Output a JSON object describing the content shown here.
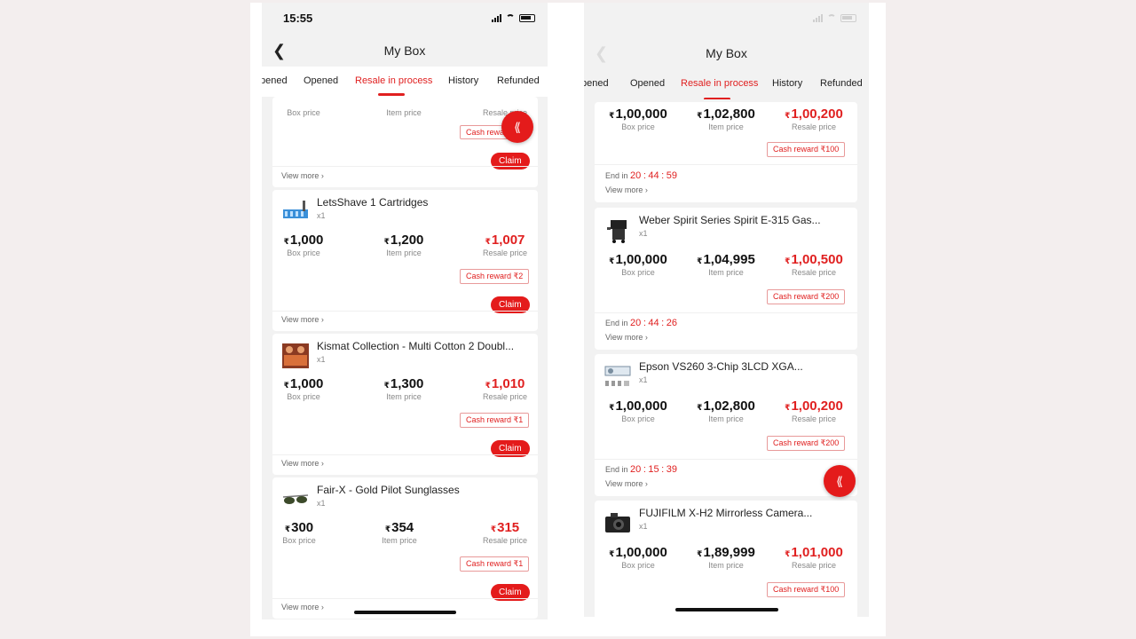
{
  "left": {
    "status_time": "15:55",
    "title": "My Box",
    "tabs": [
      "pened",
      "Opened",
      "Resale in process",
      "History",
      "Refunded"
    ],
    "partial_top": {
      "cash": "Cash reward",
      "claim": "Claim",
      "view_more": "View more ›",
      "box_label": "Box price",
      "item_label": "Item price",
      "resale_label": "Resale price"
    },
    "fab_icon": "⟪",
    "items": [
      {
        "name": "LetsShave 1 Cartridges",
        "qty": "x1",
        "box": "1,000",
        "item": "1,200",
        "resale": "1,007",
        "cash": "Cash reward ₹2",
        "claim": "Claim",
        "view_more": "View more ›"
      },
      {
        "name": "Kismat Collection - Multi Cotton 2 Doubl...",
        "qty": "x1",
        "box": "1,000",
        "item": "1,300",
        "resale": "1,010",
        "cash": "Cash reward ₹1",
        "claim": "Claim",
        "view_more": "View more ›"
      },
      {
        "name": "Fair-X - Gold Pilot Sunglasses",
        "qty": "x1",
        "box": "300",
        "item": "354",
        "resale": "315",
        "cash": "Cash reward ₹1",
        "claim": "Claim",
        "view_more": "View more ›"
      }
    ]
  },
  "right": {
    "title": "My Box",
    "tabs": [
      "pened",
      "Opened",
      "Resale in process",
      "History",
      "Refunded"
    ],
    "fab_icon": "⟪",
    "items": [
      {
        "box": "1,00,000",
        "item": "1,02,800",
        "resale": "1,00,200",
        "cash": "Cash reward ₹100",
        "end_h": "20",
        "end_m": "44",
        "end_s": "59",
        "view_more": "View more ›"
      },
      {
        "name": "Weber Spirit Series Spirit E-315 Gas...",
        "qty": "x1",
        "box": "1,00,000",
        "item": "1,04,995",
        "resale": "1,00,500",
        "cash": "Cash reward ₹200",
        "end_h": "20",
        "end_m": "44",
        "end_s": "26",
        "view_more": "View more ›"
      },
      {
        "name": "Epson VS260 3-Chip 3LCD XGA...",
        "qty": "x1",
        "box": "1,00,000",
        "item": "1,02,800",
        "resale": "1,00,200",
        "cash": "Cash reward ₹200",
        "end_h": "20",
        "end_m": "15",
        "end_s": "39",
        "view_more": "View more ›"
      },
      {
        "name": "FUJIFILM X-H2 Mirrorless Camera...",
        "qty": "x1",
        "box": "1,00,000",
        "item": "1,89,999",
        "resale": "1,01,000",
        "cash": "Cash reward ₹100"
      }
    ]
  },
  "labels": {
    "end_in": "End in",
    "box_price": "Box price",
    "item_price": "Item price",
    "resale_price": "Resale price",
    "rupee": "₹",
    "sep": ":"
  }
}
